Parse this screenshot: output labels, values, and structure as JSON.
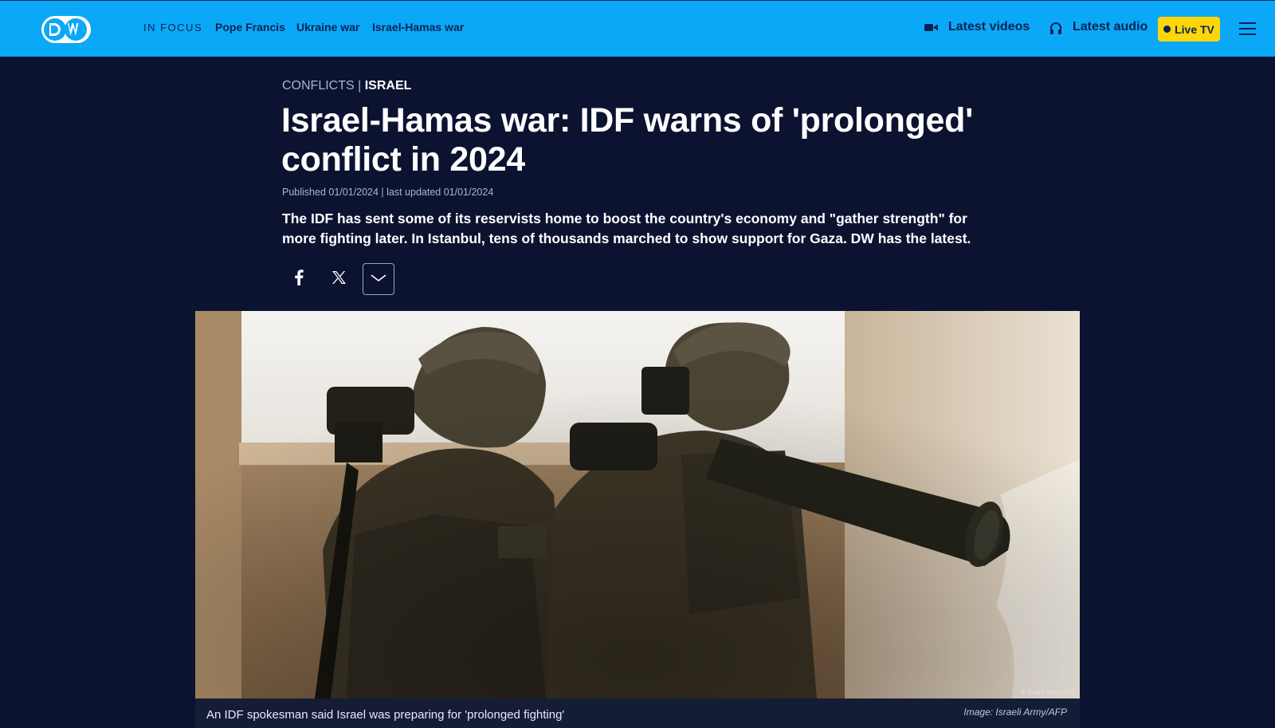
{
  "brand": {
    "logo_text": "DW"
  },
  "header": {
    "in_focus_label": "IN FOCUS",
    "focus_links": [
      "Pope Francis",
      "Ukraine war",
      "Israel-Hamas war"
    ],
    "latest_videos_label": "Latest videos",
    "latest_audio_label": "Latest audio",
    "live_tv_label": "Live TV",
    "icons": [
      "video-camera-icon",
      "headphones-icon",
      "hamburger-menu-icon"
    ]
  },
  "article": {
    "kicker_category": "CONFLICTS",
    "kicker_separator": "|",
    "kicker_topic": "ISRAEL",
    "headline": "Israel-Hamas war: IDF warns of 'prolonged' conflict in 2024",
    "dateline": "Published 01/01/2024 | last updated 01/01/2024",
    "teaser": "The IDF has sent some of its reservists home to boost the country's economy and \"gather strength\" for more fighting later. In Istanbul, tens of thousands marched to show support for Gaza. DW has the latest."
  },
  "share": {
    "icons": [
      "facebook-icon",
      "x-icon",
      "chevron-down-icon"
    ]
  },
  "hero_image": {
    "alt": "Soldiers with rocket launcher at a window",
    "watermark": "© Israeli Army/AFP",
    "caption": "An IDF spokesman said Israel was preparing for 'prolonged fighting'",
    "credit": "Image: Israeli Army/AFP"
  },
  "colors": {
    "header_bg": "#0aa8f6",
    "page_bg": "#0c1330",
    "brand_navy": "#0b2253",
    "live_badge": "#ffd60a"
  }
}
